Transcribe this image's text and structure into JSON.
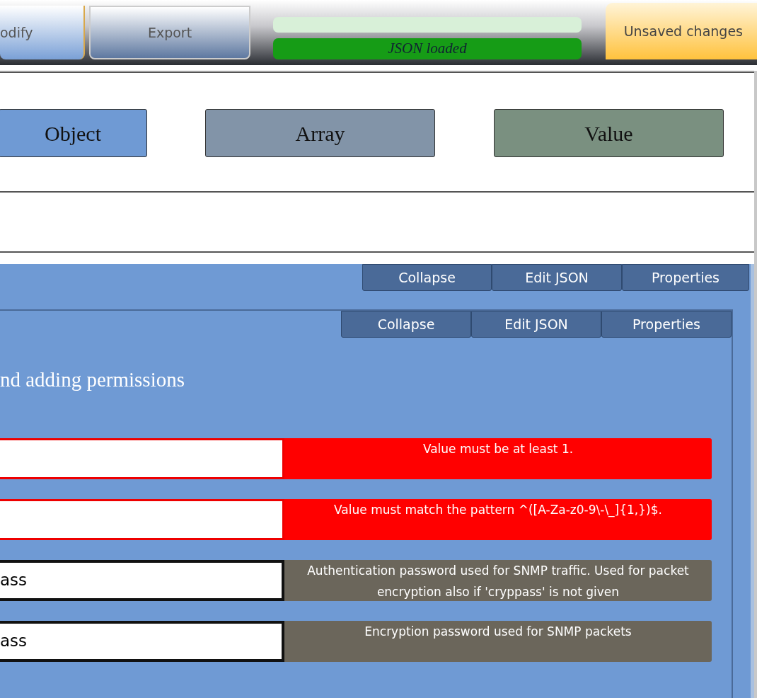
{
  "toolbar": {
    "buttons": [
      {
        "label": "odify",
        "kind": "primary"
      },
      {
        "label": "Export",
        "kind": "secondary"
      }
    ],
    "status": [
      {
        "faded": true
      },
      {
        "label": "JSON loaded",
        "faded": false
      }
    ],
    "save_state": "Unsaved changes"
  },
  "palette": [
    {
      "label": "Object",
      "kind": "object"
    },
    {
      "label": "Array",
      "kind": "array"
    },
    {
      "label": "Value",
      "kind": "value"
    }
  ],
  "outer_panel": {
    "actions": [
      "Collapse",
      "Edit JSON",
      "Properties"
    ]
  },
  "inner_panel": {
    "actions": [
      "Collapse",
      "Edit JSON",
      "Properties"
    ],
    "title": "nd adding permissions",
    "fields": [
      {
        "valid": false,
        "message": "Value must be at least 1."
      },
      {
        "valid": false,
        "message": "Value must match the pattern ^([A-Za-z0-9\\-\\_]{1,})$."
      },
      {
        "value": "ass",
        "valid": true,
        "message": "Authentication password used for SNMP traffic. Used for packet encryption also if 'cryppass' is not given"
      },
      {
        "value": "ass",
        "valid": true,
        "message": "Encryption password used for SNMP packets"
      }
    ]
  }
}
